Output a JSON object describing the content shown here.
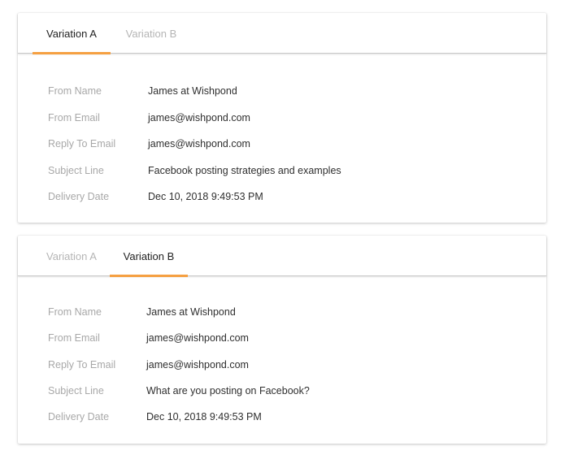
{
  "panels": [
    {
      "tabs": [
        {
          "label": "Variation A",
          "active": true
        },
        {
          "label": "Variation B",
          "active": false
        }
      ],
      "fields": [
        {
          "label": "From Name",
          "value": "James at Wishpond"
        },
        {
          "label": "From Email",
          "value": "james@wishpond.com"
        },
        {
          "label": "Reply To Email",
          "value": "james@wishpond.com"
        },
        {
          "label": "Subject Line",
          "value": "Facebook posting strategies and examples"
        },
        {
          "label": "Delivery Date",
          "value": "Dec 10, 2018 9:49:53 PM"
        }
      ]
    },
    {
      "tabs": [
        {
          "label": "Variation A",
          "active": false
        },
        {
          "label": "Variation B",
          "active": true
        }
      ],
      "fields": [
        {
          "label": "From Name",
          "value": "James at Wishpond"
        },
        {
          "label": "From Email",
          "value": "james@wishpond.com"
        },
        {
          "label": "Reply To Email",
          "value": "james@wishpond.com"
        },
        {
          "label": "Subject Line",
          "value": "What are you posting on Facebook?"
        },
        {
          "label": "Delivery Date",
          "value": "Dec 10, 2018 9:49:53 PM"
        }
      ]
    }
  ],
  "colors": {
    "accent": "#f5a042",
    "label": "#a8a8a8",
    "value": "#2f2f2f",
    "inactive_tab": "#b5b5b5"
  }
}
